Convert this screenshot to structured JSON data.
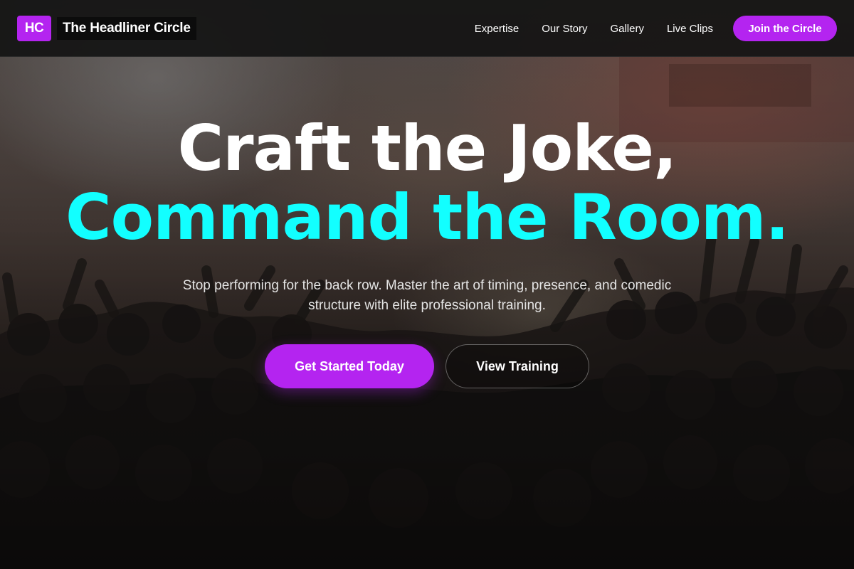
{
  "brand": {
    "badge": "HC",
    "name": "The Headliner Circle",
    "accent_color": "#b424f0",
    "highlight_color": "#12ffff"
  },
  "nav": {
    "links": [
      {
        "label": "Expertise"
      },
      {
        "label": "Our Story"
      },
      {
        "label": "Gallery"
      },
      {
        "label": "Live Clips"
      }
    ],
    "cta_label": "Join the Circle"
  },
  "hero": {
    "headline_line1": "Craft the Joke,",
    "headline_line2": "Command the Room.",
    "subtitle": "Stop performing for the back row. Master the art of timing, presence, and comedic structure with elite professional training.",
    "primary_button": "Get Started Today",
    "secondary_button": "View Training",
    "background": "concert-crowd-photo"
  }
}
